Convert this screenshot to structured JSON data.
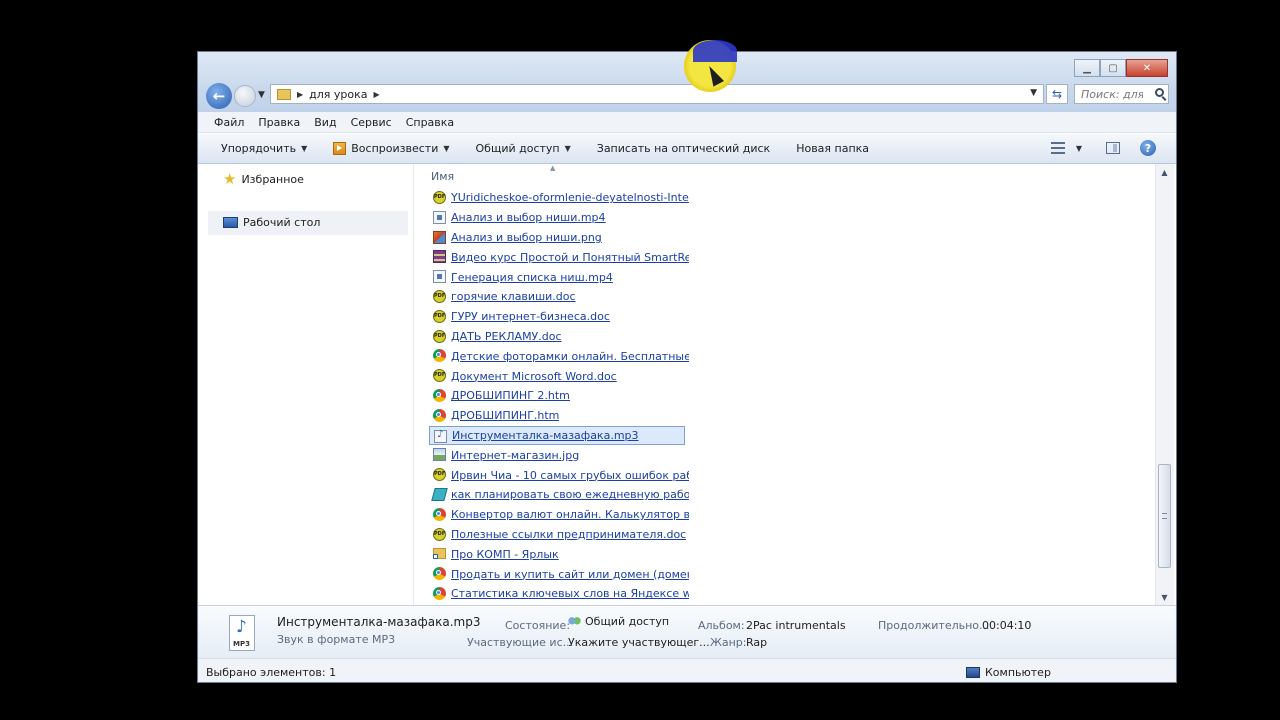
{
  "window": {
    "breadcrumb": "для урока",
    "search_placeholder": "Поиск: для..."
  },
  "menubar": [
    "Файл",
    "Правка",
    "Вид",
    "Сервис",
    "Справка"
  ],
  "toolbar": {
    "organize": "Упорядочить",
    "play": "Воспроизвести",
    "share": "Общий доступ",
    "burn": "Записать на оптический диск",
    "new_folder": "Новая папка"
  },
  "navigation": {
    "favorites": "Избранное",
    "desktop": "Рабочий стол"
  },
  "file_list": {
    "column_header": "Имя",
    "files": [
      {
        "name": "YUridicheskoe-oformlenie-deyatelnosti-Inte...",
        "icon": "pdf-icon"
      },
      {
        "name": "Анализ и выбор ниши.mp4",
        "icon": "video-file-icon"
      },
      {
        "name": "Анализ и выбор ниши.png",
        "icon": "image-file-icon"
      },
      {
        "name": "Видео курс Простой и Понятный SmartRes...",
        "icon": "archive-icon"
      },
      {
        "name": "Генерация списка ниш.mp4",
        "icon": "video-file-icon"
      },
      {
        "name": "горячие клавиши.doc",
        "icon": "pdf-icon"
      },
      {
        "name": "ГУРУ интернет-бизнеса.doc",
        "icon": "pdf-icon"
      },
      {
        "name": "ДАТЬ РЕКЛАМУ.doc",
        "icon": "pdf-icon"
      },
      {
        "name": "Детские фоторамки онлайн. Бесплатные ...",
        "icon": "chrome-icon"
      },
      {
        "name": "Документ Microsoft Word.doc",
        "icon": "pdf-icon"
      },
      {
        "name": "ДРОБШИПИНГ 2.htm",
        "icon": "chrome-icon"
      },
      {
        "name": "ДРОБШИПИНГ.htm",
        "icon": "chrome-icon"
      },
      {
        "name": "Инструменталка-мазафака.mp3",
        "icon": "audio-file-icon",
        "selected": true
      },
      {
        "name": "Интернет-магазин.jpg",
        "icon": "jpg-file-icon"
      },
      {
        "name": "Ирвин Чиа - 10 самых грубых ошибок раб...",
        "icon": "pdf-icon"
      },
      {
        "name": "как планировать свою ежедневную работ...",
        "icon": "ebook-icon"
      },
      {
        "name": "Конвертор валют онлайн. Калькулятор ва...",
        "icon": "chrome-icon"
      },
      {
        "name": "Полезные ссылки предпринимателя.doc",
        "icon": "pdf-icon"
      },
      {
        "name": "Про КОМП - Ярлык",
        "icon": "folder-shortcut-icon"
      },
      {
        "name": "Продать и купить сайт или домен (доменн...",
        "icon": "chrome-icon"
      },
      {
        "name": "Статистика ключевых слов на Яндексе  wo...",
        "icon": "chrome-icon"
      }
    ]
  },
  "details": {
    "file_name": "Инструменталка-мазафака.mp3",
    "file_type": "Звук в формате MP3",
    "thumb_label": "MP3",
    "state_label": "Состояние:",
    "state_value": "Общий доступ",
    "participants_label": "Участвующие ис...",
    "participants_value": "Укажите участвующег...",
    "album_label": "Альбом:",
    "album_value": "2Pac intrumentals",
    "genre_label": "Жанр:",
    "genre_value": "Rap",
    "duration_label": "Продолжительно...",
    "duration_value": "00:04:10"
  },
  "status": {
    "selected": "Выбрано элементов: 1",
    "location": "Компьютер"
  }
}
